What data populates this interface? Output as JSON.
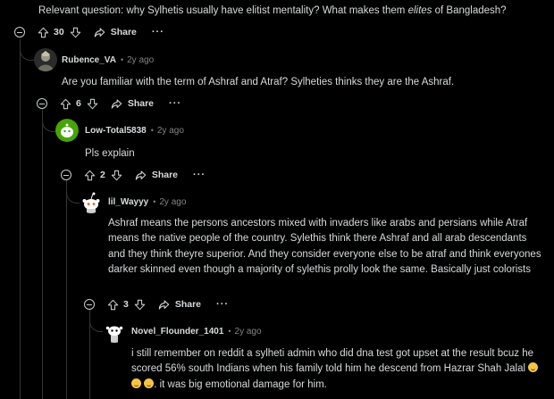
{
  "top_comment": {
    "text": "Relevant question: why Sylhetis usually have elitist mentality? What makes them",
    "text_em": "elites",
    "text_end": "of Bangladesh?",
    "score": "30",
    "share_label": "Share",
    "more_label": "···"
  },
  "comments": [
    {
      "username": "Rubence_VA",
      "dot": "•",
      "time": "2y ago",
      "text": "Are you familiar with the term of Ashraf and Atraf? Sylheties thinks they are the Ashraf.",
      "score": "6",
      "share_label": "Share",
      "more_label": "···"
    },
    {
      "username": "Low-Total5838",
      "dot": "•",
      "time": "2y ago",
      "text": "Pls explain",
      "score": "2",
      "share_label": "Share",
      "more_label": "···"
    },
    {
      "username": "lil_Wayyy",
      "dot": "•",
      "time": "2y ago",
      "text": "Ashraf means the persons ancestors mixed with invaders like arabs and persians while Atraf means the native people of the country. Sylethis think there Ashraf and all arab descendants and they think theyre superior. And they consider everyone else to be atraf and think everyones darker skinned even though a majority of sylethis prolly look the same. Basically just colorists",
      "score": "3",
      "share_label": "Share",
      "more_label": "···"
    },
    {
      "username": "Novel_Flounder_1401",
      "dot": "•",
      "time": "2y ago",
      "text_part1": "i still remember on reddit a sylheti admin who did dna test got upset at the result bcuz he scored 56% south Indians when his family told him he descend from Hazrar Shah Jalal",
      "text_part2": ". it was big emotional damage for him."
    }
  ],
  "icons": {
    "upvote": "upvote-arrow-icon",
    "downvote": "downvote-arrow-icon",
    "share": "share-arrow-icon",
    "emoji": "rolling-laughing-emoji-icon"
  },
  "colors": {
    "background": "#000000",
    "text": "#d7dadc",
    "meta": "#818384",
    "thread_line": "#343536"
  }
}
